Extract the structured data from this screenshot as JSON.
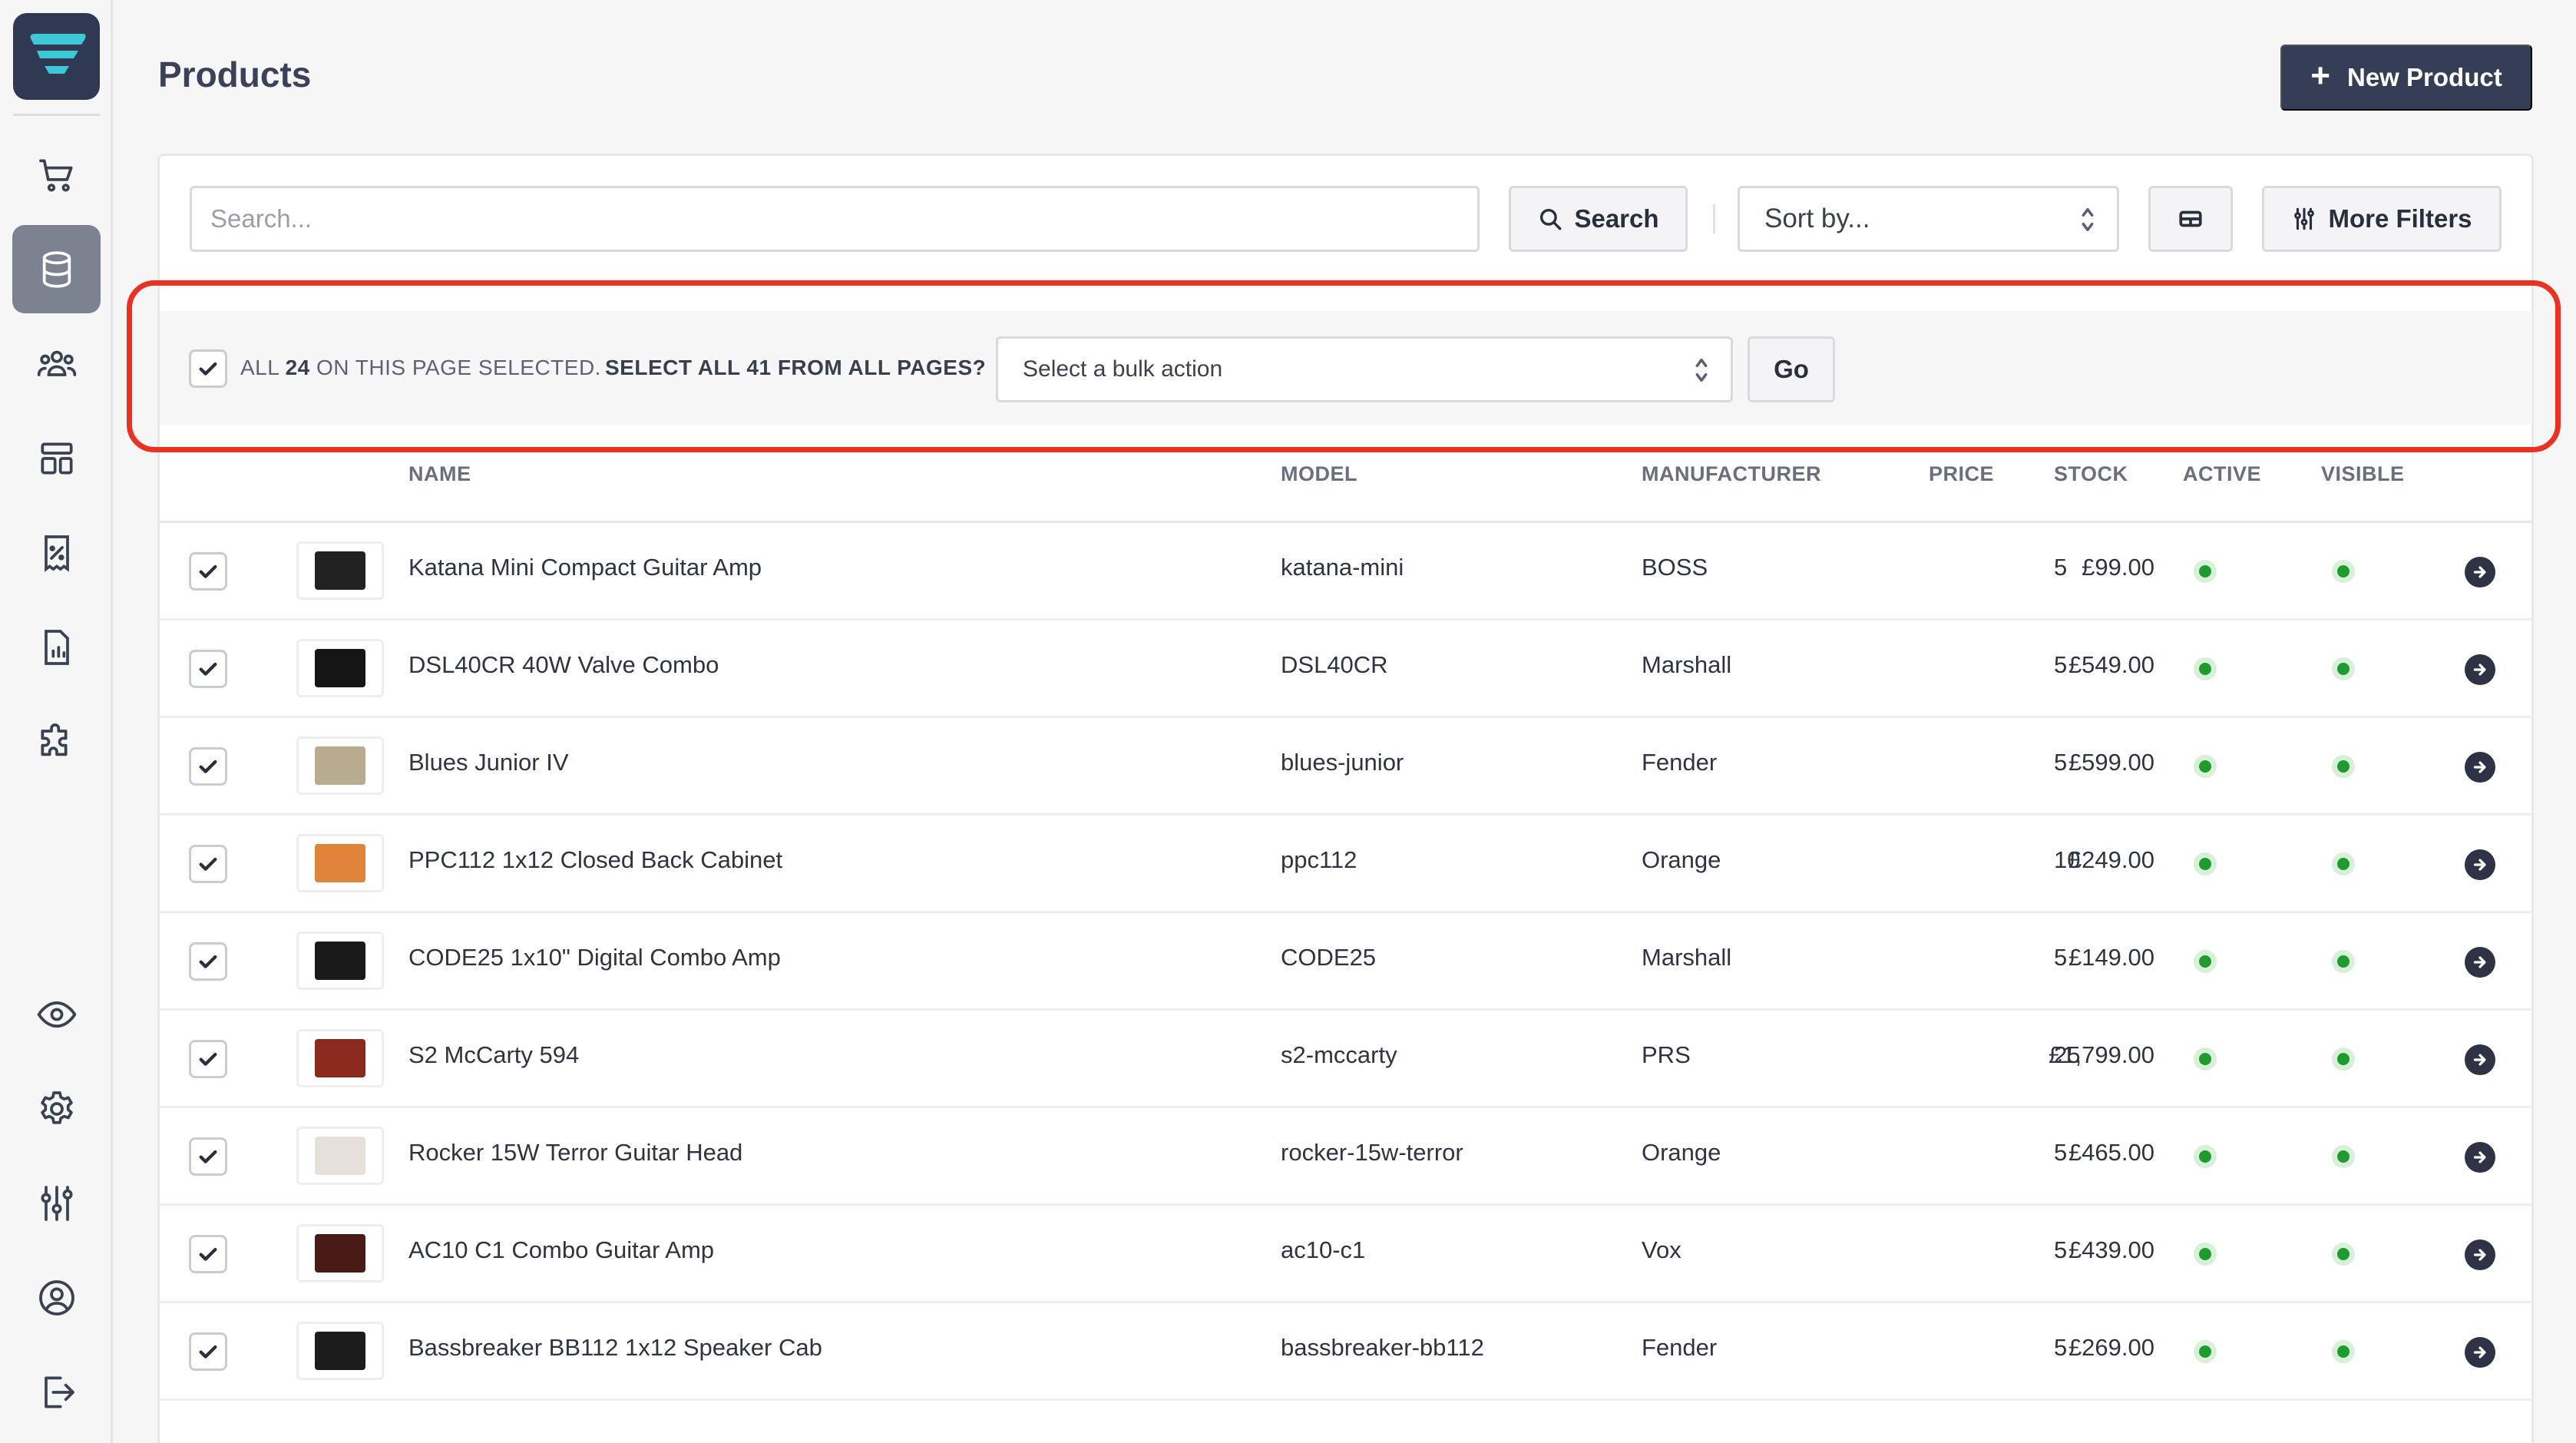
{
  "page": {
    "title": "Products"
  },
  "header": {
    "new_product_label": "New Product"
  },
  "toolbar": {
    "search_placeholder": "Search...",
    "search_label": "Search",
    "sort_label": "Sort by...",
    "more_filters_label": "More Filters"
  },
  "bulk": {
    "selected_prefix": "ALL",
    "selected_count": "24",
    "selected_suffix": "ON THIS PAGE SELECTED.",
    "select_all_label": "SELECT ALL 41 FROM ALL PAGES?",
    "action_placeholder": "Select a bulk action",
    "go_label": "Go"
  },
  "table": {
    "columns": [
      "NAME",
      "MODEL",
      "MANUFACTURER",
      "PRICE",
      "STOCK",
      "ACTIVE",
      "VISIBLE"
    ],
    "rows": [
      {
        "name": "Katana Mini Compact Guitar Amp",
        "model": "katana-mini",
        "manufacturer": "BOSS",
        "price": "£99.00",
        "stock": "5",
        "thumb_color": "#222222"
      },
      {
        "name": "DSL40CR 40W Valve Combo",
        "model": "DSL40CR",
        "manufacturer": "Marshall",
        "price": "£549.00",
        "stock": "5",
        "thumb_color": "#151515"
      },
      {
        "name": "Blues Junior IV",
        "model": "blues-junior",
        "manufacturer": "Fender",
        "price": "£599.00",
        "stock": "5",
        "thumb_color": "#b8ab8e"
      },
      {
        "name": "PPC112 1x12 Closed Back Cabinet",
        "model": "ppc112",
        "manufacturer": "Orange",
        "price": "£249.00",
        "stock": "10",
        "thumb_color": "#e0843a"
      },
      {
        "name": "CODE25 1x10\" Digital Combo Amp",
        "model": "CODE25",
        "manufacturer": "Marshall",
        "price": "£149.00",
        "stock": "5",
        "thumb_color": "#1a1a1a"
      },
      {
        "name": "S2 McCarty 594",
        "model": "s2-mccarty",
        "manufacturer": "PRS",
        "price": "£1,799.00",
        "stock": "25",
        "thumb_color": "#8a2a1c"
      },
      {
        "name": "Rocker 15W Terror Guitar Head",
        "model": "rocker-15w-terror",
        "manufacturer": "Orange",
        "price": "£465.00",
        "stock": "5",
        "thumb_color": "#e6e1d8"
      },
      {
        "name": "AC10 C1 Combo Guitar Amp",
        "model": "ac10-c1",
        "manufacturer": "Vox",
        "price": "£439.00",
        "stock": "5",
        "thumb_color": "#4a1b16"
      },
      {
        "name": "Bassbreaker BB112 1x12 Speaker Cab",
        "model": "bassbreaker-bb112",
        "manufacturer": "Fender",
        "price": "£269.00",
        "stock": "5",
        "thumb_color": "#1c1c1c"
      }
    ]
  },
  "colors": {
    "accent": "#353e55",
    "highlight": "#ea3223",
    "status_green": "#1f9a2f"
  }
}
